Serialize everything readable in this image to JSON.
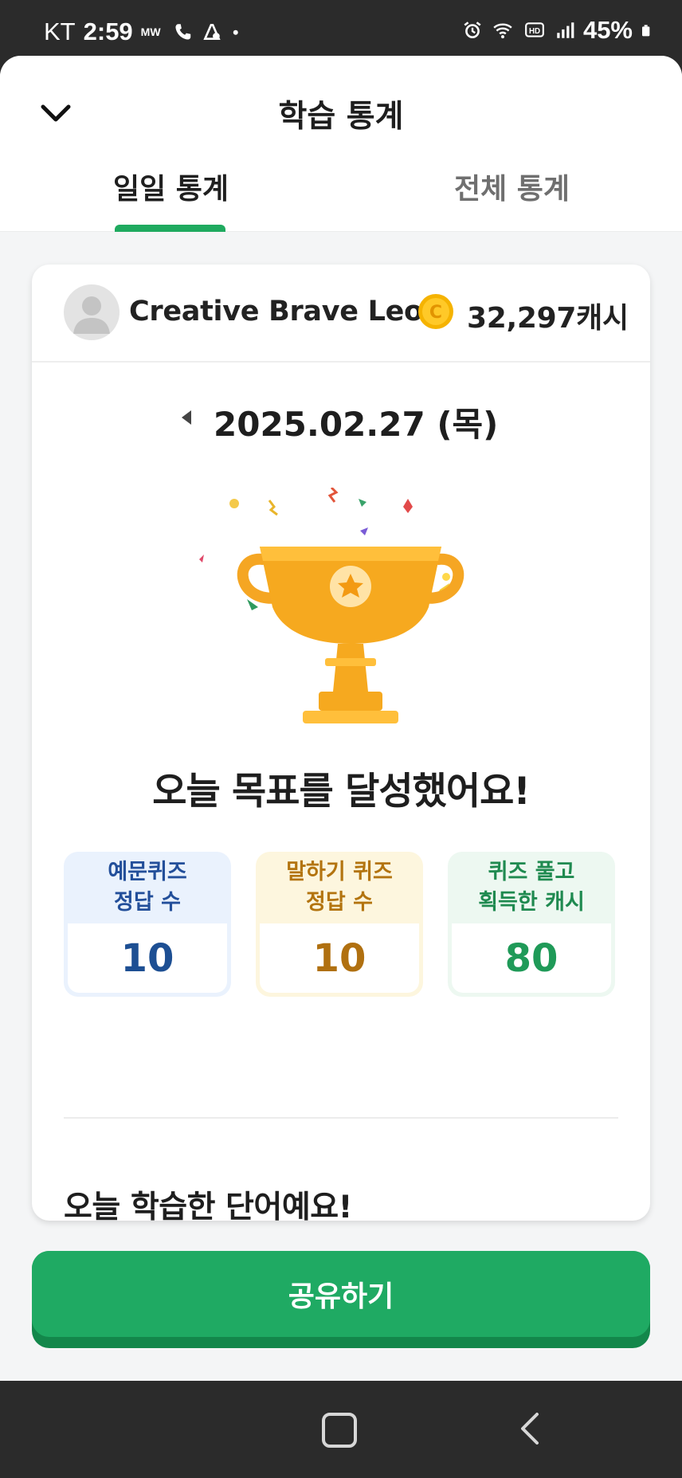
{
  "status_bar": {
    "carrier": "KT",
    "time": "2:59",
    "battery": "45%",
    "icons": [
      "mw-icon",
      "phone-icon",
      "app-icon",
      "dot-icon",
      "alarm-icon",
      "wifi-icon",
      "hd-icon",
      "signal-icon",
      "battery-icon"
    ]
  },
  "header": {
    "title": "학습 통계",
    "back_icon": "chevron-down-icon",
    "tabs": [
      {
        "label": "일일 통계",
        "selected": true
      },
      {
        "label": "전체 통계",
        "selected": false
      }
    ]
  },
  "profile": {
    "name": "Creative Brave Leon",
    "cash": "32,297캐시",
    "coin_letter": "C"
  },
  "date": {
    "value": "2025.02.27 (목)"
  },
  "goal": {
    "message": "오늘 목표를 달성했어요!"
  },
  "stats": [
    {
      "line1": "예문퀴즈",
      "line2": "정답 수",
      "value": "10"
    },
    {
      "line1": "말하기 퀴즈",
      "line2": "정답 수",
      "value": "10"
    },
    {
      "line1": "퀴즈 풀고",
      "line2": "획득한 캐시",
      "value": "80"
    }
  ],
  "words": {
    "title": "오늘 학습한 단어예요!"
  },
  "share": {
    "label": "공유하기"
  },
  "colors": {
    "accent": "#1faa63",
    "tab_indicator": "#1faa5f",
    "quiz": "#1d4f93",
    "speak": "#b07010",
    "cash": "#1f9a58"
  }
}
